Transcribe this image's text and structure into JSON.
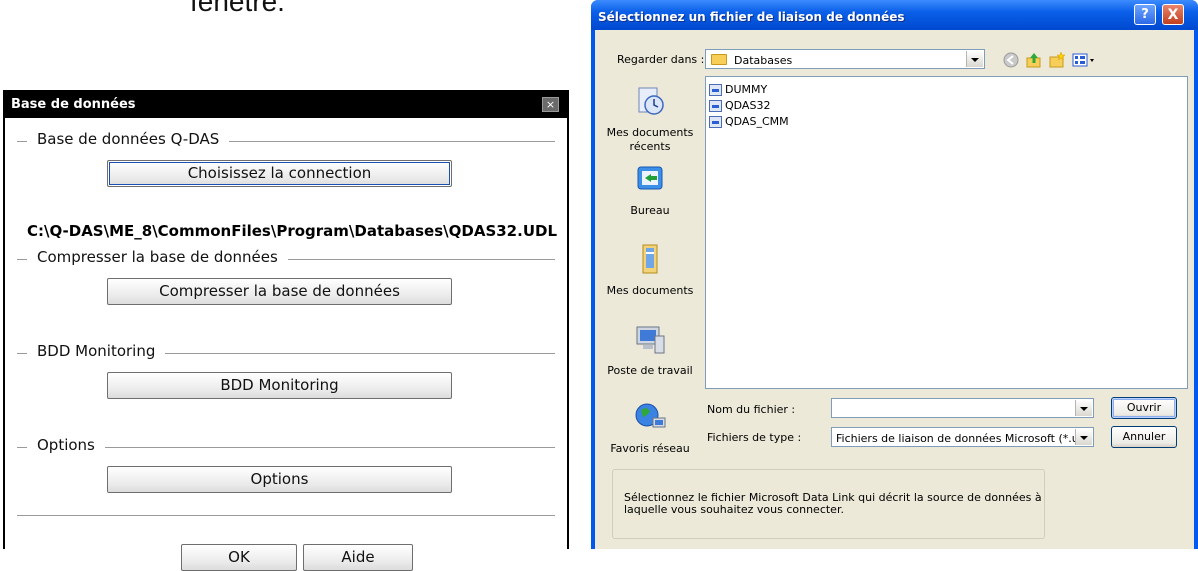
{
  "background": {
    "caption_fragment": "fenêtre."
  },
  "db_dialog": {
    "title": "Base de données",
    "close_glyph": "×",
    "sections": {
      "qdas_db": {
        "label": "Base de données Q-DAS",
        "button": "Choisissez la connection",
        "path": "C:\\Q-DAS\\ME_8\\CommonFiles\\Program\\Databases\\QDAS32.UDL"
      },
      "compress": {
        "label": "Compresser la base de données",
        "button": "Compresser la base de données"
      },
      "monitoring": {
        "label": "BDD Monitoring",
        "button": "BDD Monitoring"
      },
      "options": {
        "label": "Options",
        "button": "Options"
      }
    },
    "ok": "OK",
    "help": "Aide"
  },
  "file_dialog": {
    "title": "Sélectionnez un fichier de liaison de données",
    "help_glyph": "?",
    "close_glyph": "X",
    "look_in_label": "Regarder dans :",
    "look_in_value": "Databases",
    "places": [
      {
        "label": "Mes documents récents",
        "icon": "recent-documents-icon"
      },
      {
        "label": "Bureau",
        "icon": "desktop-icon"
      },
      {
        "label": "Mes documents",
        "icon": "my-documents-icon"
      },
      {
        "label": "Poste de travail",
        "icon": "my-computer-icon"
      },
      {
        "label": "Favoris réseau",
        "icon": "network-places-icon"
      }
    ],
    "files": [
      "DUMMY",
      "QDAS32",
      "QDAS_CMM"
    ],
    "file_name_label": "Nom du fichier :",
    "file_name_value": "",
    "file_type_label": "Fichiers de type :",
    "file_type_value": "Fichiers de liaison de données Microsoft (*.udl)",
    "open_button": "Ouvrir",
    "cancel_button": "Annuler",
    "info_text": "Sélectionnez le fichier Microsoft Data Link qui décrit la source de données à laquelle vous souhaitez vous connecter.",
    "colors": {
      "xp_title_blue": "#0058ee",
      "dialog_face": "#ece9d8"
    }
  }
}
